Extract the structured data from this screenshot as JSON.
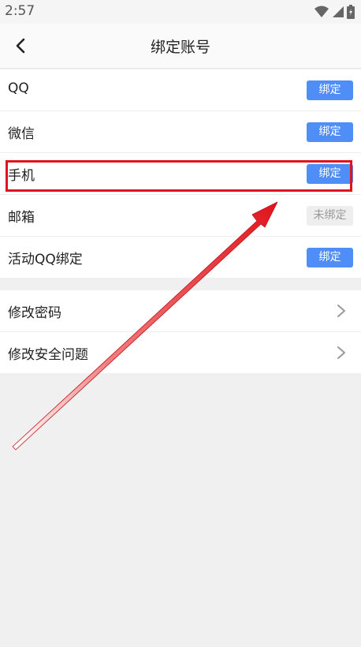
{
  "status_bar": {
    "time": "2:57"
  },
  "nav": {
    "title": "绑定账号"
  },
  "accounts": [
    {
      "label": "QQ",
      "action": "绑定",
      "state": "bound"
    },
    {
      "label": "微信",
      "action": "绑定",
      "state": "bound"
    },
    {
      "label": "手机",
      "action": "绑定",
      "state": "bound"
    },
    {
      "label": "邮箱",
      "action": "未绑定",
      "state": "unbound"
    },
    {
      "label": "活动QQ绑定",
      "action": "绑定",
      "state": "bound"
    }
  ],
  "security": [
    {
      "label": "修改密码"
    },
    {
      "label": "修改安全问题"
    }
  ],
  "colors": {
    "accent": "#4f8ef7",
    "highlight": "#e0141c",
    "background": "#f0f0f0"
  },
  "icons": [
    "wifi-icon",
    "signal-icon",
    "battery-icon",
    "back-arrow-icon",
    "chevron-right-icon"
  ]
}
